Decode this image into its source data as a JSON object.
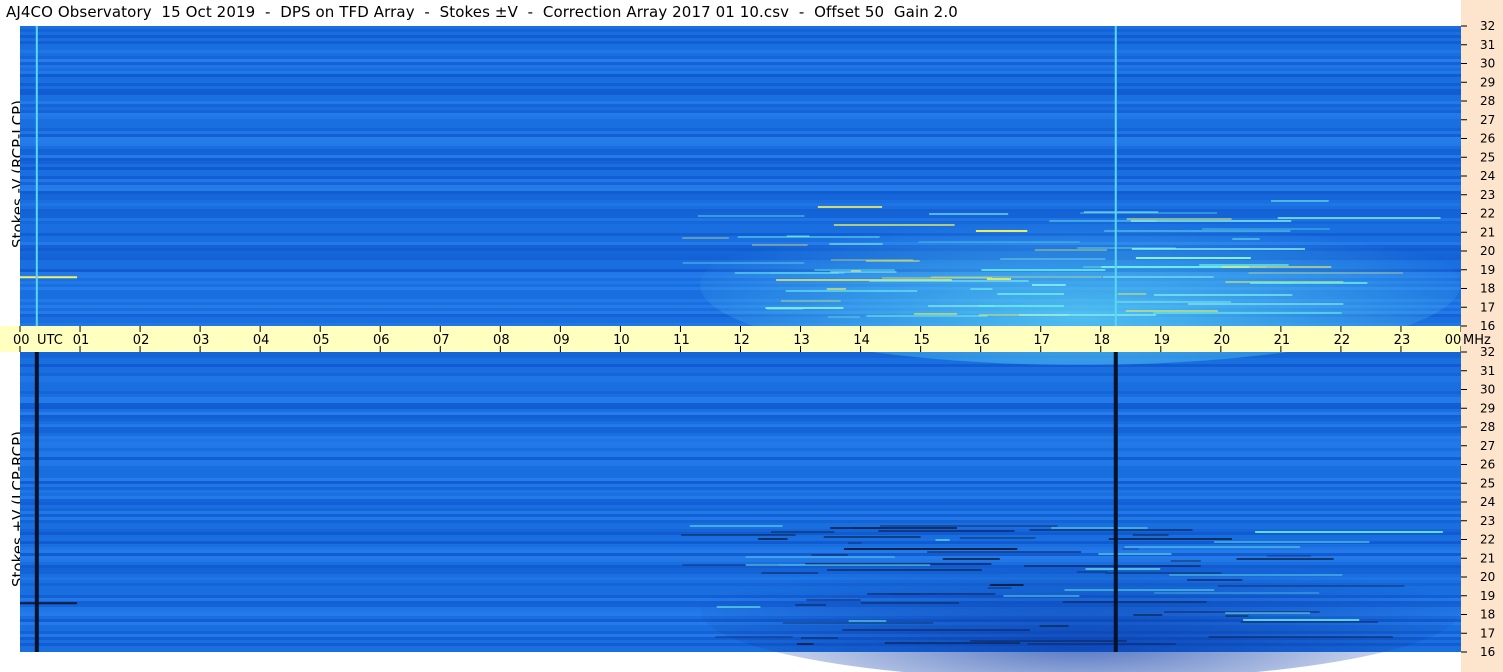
{
  "title": "AJ4CO Observatory  15 Oct 2019  -  DPS on TFD Array  -  Stokes ±V  -  Correction Array 2017 01 10.csv  -  Offset 50  Gain 2.0",
  "colors": {
    "background": "#1a6fe0",
    "band_dark": "#0c4fc8",
    "band_light": "#2e86f2",
    "time_axis_bg": "#ffffc0",
    "freq_axis_bg": "#fde4cc",
    "burst_cyan": "#6ff2e6",
    "burst_yellow": "#f0f060",
    "dark_line": "#0a1a3a"
  },
  "chart_data": [
    {
      "type": "heatmap",
      "panel": "top",
      "ylabel": "Stokes -V (RCP-LCP)",
      "y_unit": "MHz",
      "ylim": [
        16,
        32
      ],
      "yticks": [
        "32",
        "31",
        "30",
        "29",
        "28",
        "27",
        "26",
        "25",
        "24",
        "23",
        "22",
        "21",
        "20",
        "19",
        "18",
        "17",
        "16"
      ],
      "xlim": [
        0,
        24
      ],
      "vertical_line_hours": [
        0.28,
        18.25
      ]
    },
    {
      "type": "heatmap",
      "panel": "bottom",
      "ylabel": "Stokes +V (LCP-RCP)",
      "y_unit": "MHz",
      "ylim": [
        16,
        32
      ],
      "yticks": [
        "32",
        "31",
        "30",
        "29",
        "28",
        "27",
        "26",
        "25",
        "24",
        "23",
        "22",
        "21",
        "20",
        "19",
        "18",
        "17",
        "16"
      ],
      "xlim": [
        0,
        24
      ],
      "vertical_line_hours": [
        0.28,
        18.25
      ]
    }
  ],
  "time_axis": {
    "labels": [
      "00",
      "01",
      "02",
      "03",
      "04",
      "05",
      "06",
      "07",
      "08",
      "09",
      "10",
      "11",
      "12",
      "13",
      "14",
      "15",
      "16",
      "17",
      "18",
      "19",
      "20",
      "21",
      "22",
      "23",
      "00"
    ],
    "unit_left": "UTC",
    "unit_right": "MHz"
  }
}
